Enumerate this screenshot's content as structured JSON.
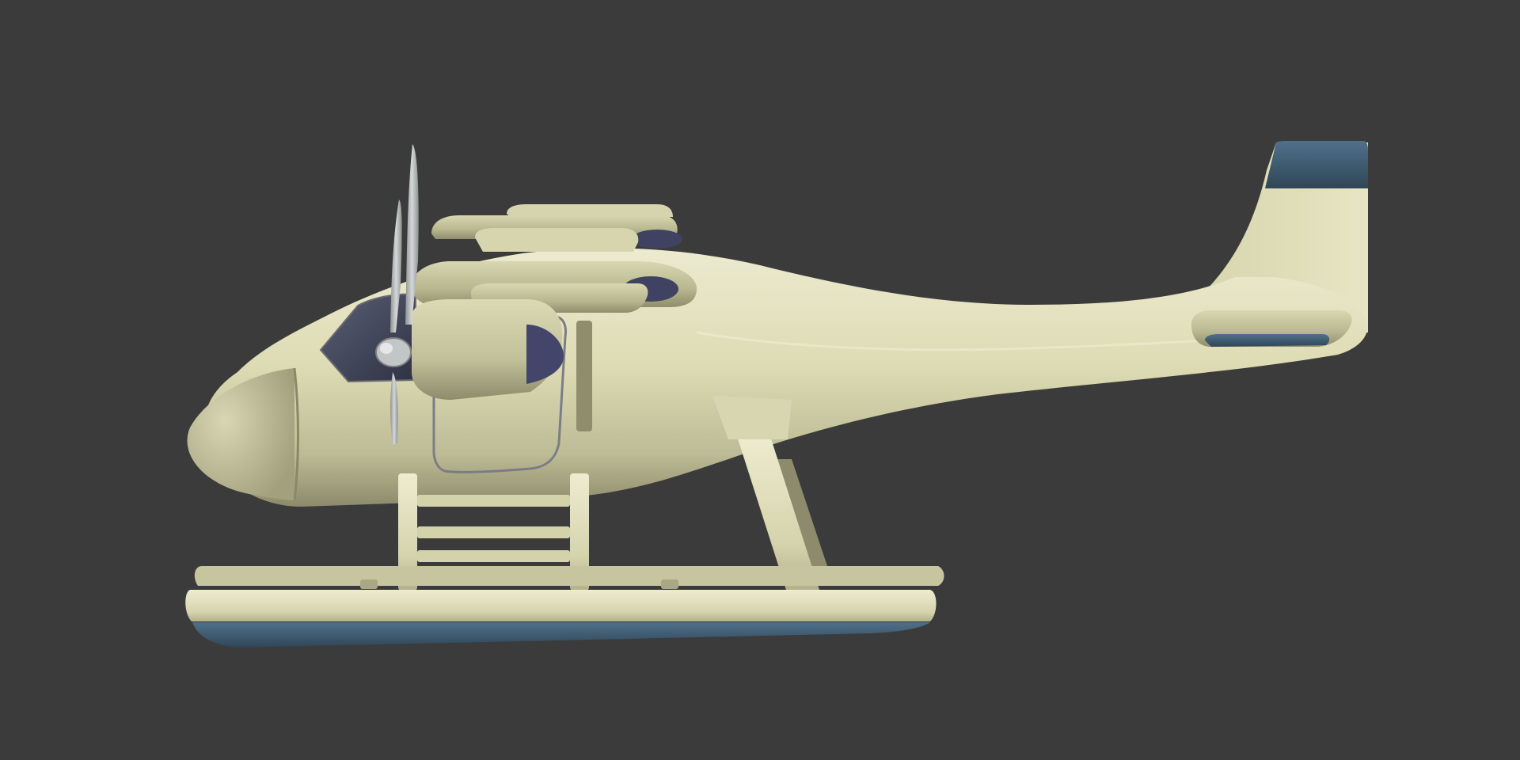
{
  "scene": {
    "colors": {
      "background": "#3b3b3b",
      "body_light": "#e3e0b6",
      "body_mid": "#cfcca2",
      "body_shadow": "#9e9b78",
      "accent_blue": "#466278",
      "glass": "#3e4256",
      "engine_intake": "#43466a",
      "propeller": "#b9bcbc",
      "outline": "#6f6f74"
    },
    "subject": "seaplane-3d-render"
  }
}
